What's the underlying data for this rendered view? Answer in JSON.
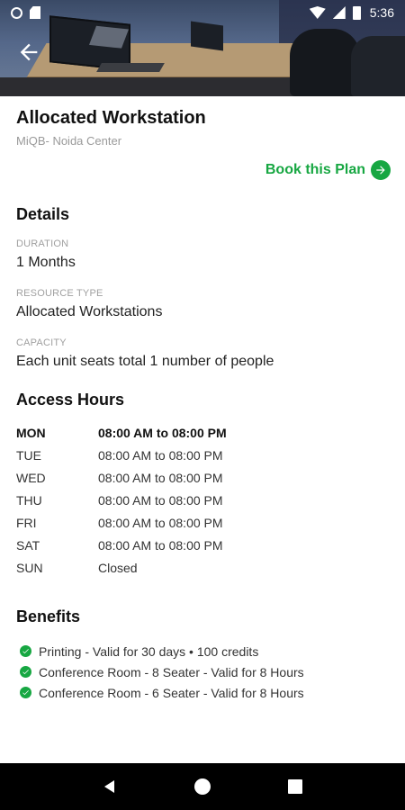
{
  "status_bar": {
    "time": "5:36"
  },
  "header": {
    "back_icon": "arrow-left-icon"
  },
  "plan": {
    "title": "Allocated Workstation",
    "location": "MiQB- Noida Center",
    "book_label": "Book this Plan",
    "book_icon": "arrow-right-circle-icon"
  },
  "details": {
    "heading": "Details",
    "fields": [
      {
        "label": "DURATION",
        "value": "1 Months"
      },
      {
        "label": "RESOURCE TYPE",
        "value": "Allocated Workstations"
      },
      {
        "label": "CAPACITY",
        "value": "Each unit seats total 1 number of people"
      }
    ]
  },
  "access_hours": {
    "heading": "Access Hours",
    "rows": [
      {
        "day": "MON",
        "hours": "08:00 AM to 08:00 PM",
        "active": true
      },
      {
        "day": "TUE",
        "hours": "08:00 AM to 08:00 PM"
      },
      {
        "day": "WED",
        "hours": "08:00 AM to 08:00 PM"
      },
      {
        "day": "THU",
        "hours": "08:00 AM to 08:00 PM"
      },
      {
        "day": "FRI",
        "hours": "08:00 AM to 08:00 PM"
      },
      {
        "day": "SAT",
        "hours": "08:00 AM to 08:00 PM"
      },
      {
        "day": "SUN",
        "hours": "Closed"
      }
    ]
  },
  "benefits": {
    "heading": "Benefits",
    "items": [
      "Printing - Valid for 30 days  • 100 credits",
      "Conference Room - 8 Seater - Valid for 8 Hours",
      "Conference Room - 6 Seater - Valid for 8 Hours"
    ]
  },
  "colors": {
    "accent": "#17a742",
    "muted": "#9a9a9a"
  }
}
